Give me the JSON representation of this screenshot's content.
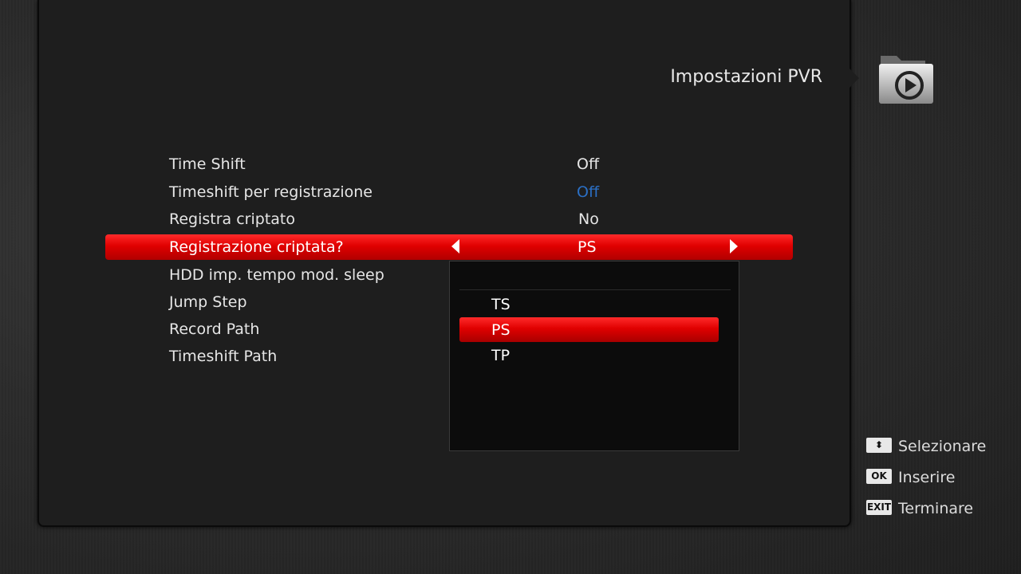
{
  "header": {
    "title": "Impostazioni PVR",
    "icon": "pvr-folder-play-icon"
  },
  "menu": {
    "items": [
      {
        "label": "Time Shift",
        "value": "Off"
      },
      {
        "label": "Timeshift per registrazione",
        "value": "Off"
      },
      {
        "label": "Registra criptato",
        "value": "No"
      },
      {
        "label": "Registrazione criptata?",
        "value": "PS",
        "selected": true
      },
      {
        "label": "HDD imp. tempo mod. sleep",
        "value": ""
      },
      {
        "label": "Jump Step",
        "value": ""
      },
      {
        "label": "Record Path",
        "value": ""
      },
      {
        "label": "Timeshift Path",
        "value": ""
      }
    ]
  },
  "dropdown": {
    "options": [
      "TS",
      "PS",
      "TP"
    ],
    "selected": "PS"
  },
  "help": [
    {
      "key": "⬍",
      "label": "Selezionare"
    },
    {
      "key": "OK",
      "label": "Inserire"
    },
    {
      "key": "EXIT",
      "label": "Terminare"
    }
  ],
  "colors": {
    "highlight": "#e00000",
    "disabled_value": "#2b6fc4",
    "panel": "#1e1e1e"
  }
}
